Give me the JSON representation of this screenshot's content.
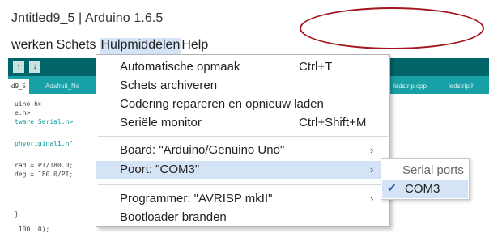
{
  "window": {
    "title": "Jntitled9_5 | Arduino 1.6.5"
  },
  "menubar": {
    "items": [
      "werken",
      "Schets",
      "Hulpmiddelen",
      "Help"
    ],
    "active": "Hulpmiddelen"
  },
  "toolbar": {
    "buttons": [
      "↑",
      "↓"
    ]
  },
  "tabs": {
    "items": [
      "d9_5",
      "Adafruit_Ne",
      "ledstrip.cpp",
      "ledstrip.h"
    ]
  },
  "code": {
    "lines": [
      "uino.h>",
      "e.h>",
      "tware Serial.h>",
      "",
      "phyoriginal1.h\"",
      "",
      "rad = PI/180.0;",
      "deg = 180.0/PI;",
      "",
      "",
      "",
      "}",
      " 100, 0);"
    ]
  },
  "menu": {
    "items": [
      {
        "label": "Automatische opmaak",
        "shortcut": "Ctrl+T"
      },
      {
        "label": "Schets archiveren",
        "shortcut": ""
      },
      {
        "label": "Codering repareren en opnieuw laden",
        "shortcut": ""
      },
      {
        "label": "Seriële monitor",
        "shortcut": "Ctrl+Shift+M"
      },
      {
        "label": "Board: \"Arduino/Genuino Uno\"",
        "shortcut": "",
        "submenu": true
      },
      {
        "label": "Poort: \"COM3\"",
        "shortcut": "",
        "submenu": true,
        "highlighted": true
      },
      {
        "label": "Programmer: \"AVRISP mkII\"",
        "shortcut": "",
        "submenu": true
      },
      {
        "label": "Bootloader branden",
        "shortcut": ""
      }
    ]
  },
  "submenu": {
    "header": "Serial ports",
    "item": "COM3",
    "check_icon": "checkmark-icon"
  },
  "colors": {
    "toolbar": "#006468",
    "tabbar": "#17a0a6",
    "highlight": "#d4e4f6",
    "annotation": "#a3161d"
  }
}
